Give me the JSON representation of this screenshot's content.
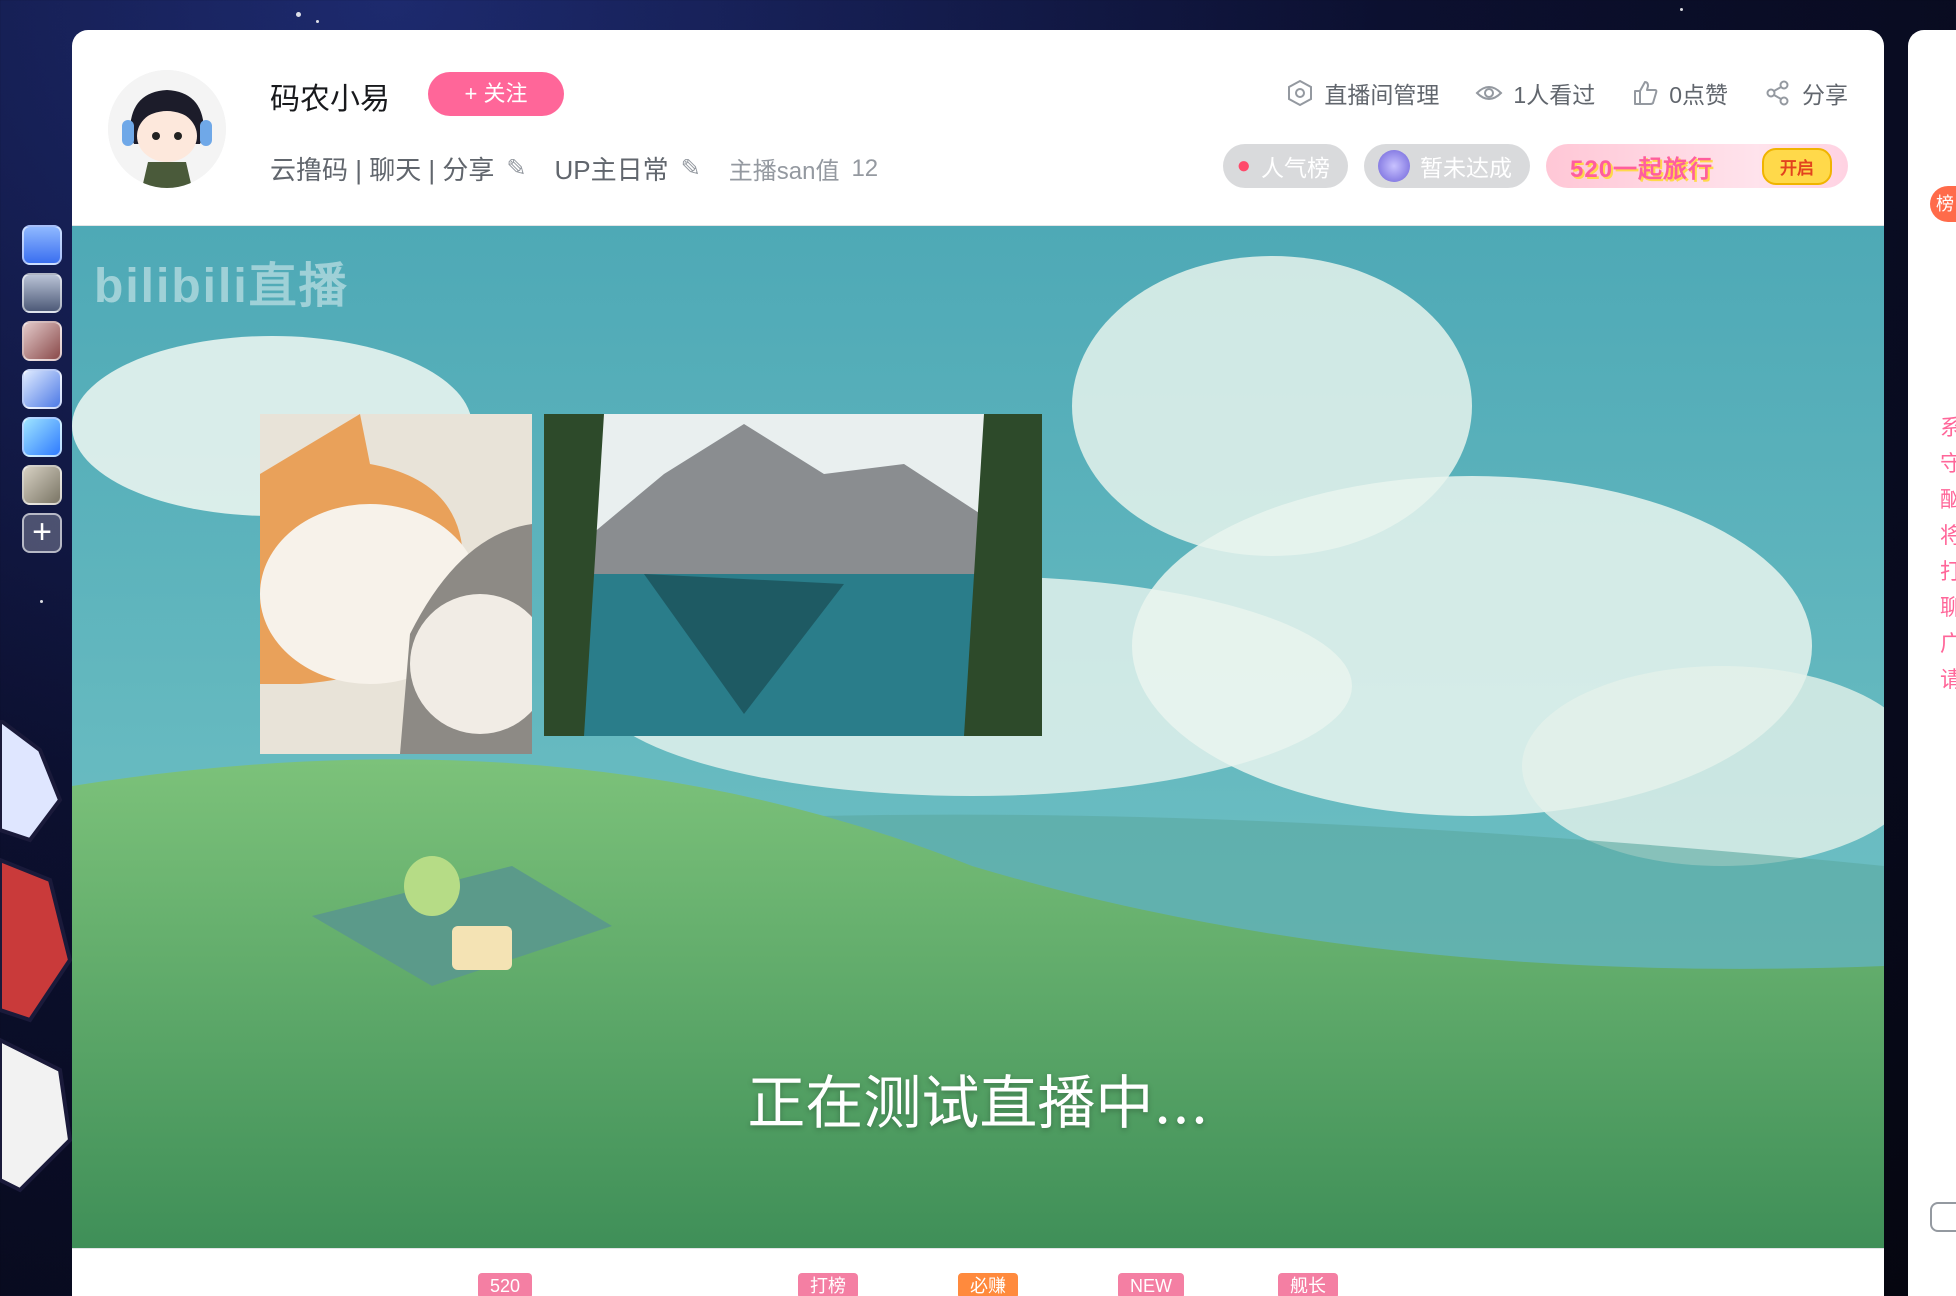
{
  "streamer": {
    "name": "码农小易",
    "follow_label": "+ 关注",
    "tags": [
      "云撸码 | 聊天 | 分享",
      "UP主日常"
    ],
    "san_label": "主播san值",
    "san_value": "12"
  },
  "top_actions": [
    {
      "icon": "settings-icon",
      "label": "直播间管理"
    },
    {
      "icon": "eye-icon",
      "label": "1人看过"
    },
    {
      "icon": "thumbs-up-icon",
      "label": "0点赞"
    },
    {
      "icon": "share-icon",
      "label": "分享"
    }
  ],
  "pills": {
    "popularity": "人气榜",
    "status": "暂未达成"
  },
  "event": {
    "title": "520一起旅行",
    "button": "开启"
  },
  "player": {
    "watermark": "bilibili直播",
    "status_text": "正在测试直播中..."
  },
  "gift_badges": [
    {
      "label": "520",
      "color": "#f47fa3"
    },
    {
      "label": "打榜",
      "color": "#f47fa3"
    },
    {
      "label": "必赚",
      "color": "#ff8a3d"
    },
    {
      "label": "NEW",
      "color": "#f47fa3"
    },
    {
      "label": "舰长",
      "color": "#f47fa3"
    }
  ],
  "side_panel": {
    "rank_label": "榜",
    "notice_chars": [
      "系",
      "守",
      "酗",
      "将",
      "打",
      "聊",
      "广",
      "请"
    ]
  },
  "colors": {
    "accent": "#ff6699",
    "sky": "#5fb8c4",
    "grass": "#5fa86a"
  }
}
